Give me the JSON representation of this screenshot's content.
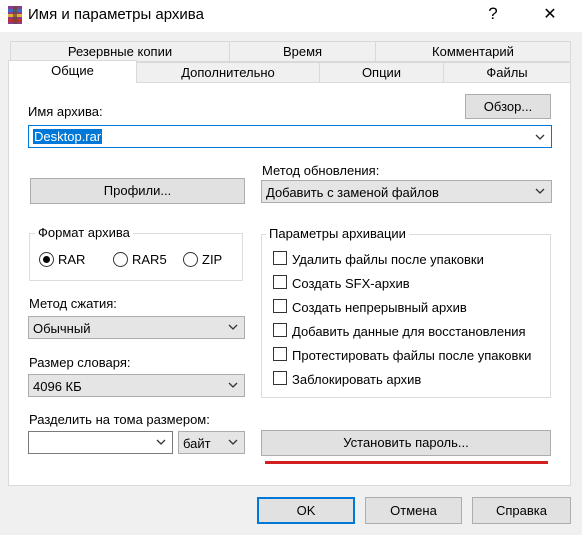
{
  "window": {
    "title": "Имя и параметры архива",
    "help_glyph": "?",
    "close_glyph": "✕"
  },
  "tabs": {
    "row1": [
      "Резервные копии",
      "Время",
      "Комментарий"
    ],
    "row2": [
      "Общие",
      "Дополнительно",
      "Опции",
      "Файлы"
    ],
    "active": "Общие"
  },
  "archive_name": {
    "label": "Имя архива:",
    "value": "Desktop.rar",
    "browse_label": "Обзор..."
  },
  "update_method": {
    "label": "Метод обновления:",
    "value": "Добавить с заменой файлов"
  },
  "profiles_label": "Профили...",
  "format": {
    "title": "Формат архива",
    "options": [
      "RAR",
      "RAR5",
      "ZIP"
    ],
    "selected": "RAR"
  },
  "compression": {
    "label": "Метод сжатия:",
    "value": "Обычный"
  },
  "dictionary": {
    "label": "Размер словаря:",
    "value": "4096 КБ"
  },
  "split": {
    "label": "Разделить на тома размером:",
    "value": "",
    "unit": "байт"
  },
  "archive_options": {
    "title": "Параметры архивации",
    "items": [
      {
        "label": "Удалить файлы после упаковки",
        "checked": false
      },
      {
        "label": "Создать SFX-архив",
        "checked": false
      },
      {
        "label": "Создать непрерывный архив",
        "checked": false
      },
      {
        "label": "Добавить данные для восстановления",
        "checked": false
      },
      {
        "label": "Протестировать файлы после упаковки",
        "checked": false
      },
      {
        "label": "Заблокировать архив",
        "checked": false
      }
    ]
  },
  "set_password_label": "Установить пароль...",
  "buttons": {
    "ok": "OK",
    "cancel": "Отмена",
    "help": "Справка"
  },
  "colors": {
    "accent": "#0078d7",
    "highlight_underline": "#d21f1f"
  }
}
